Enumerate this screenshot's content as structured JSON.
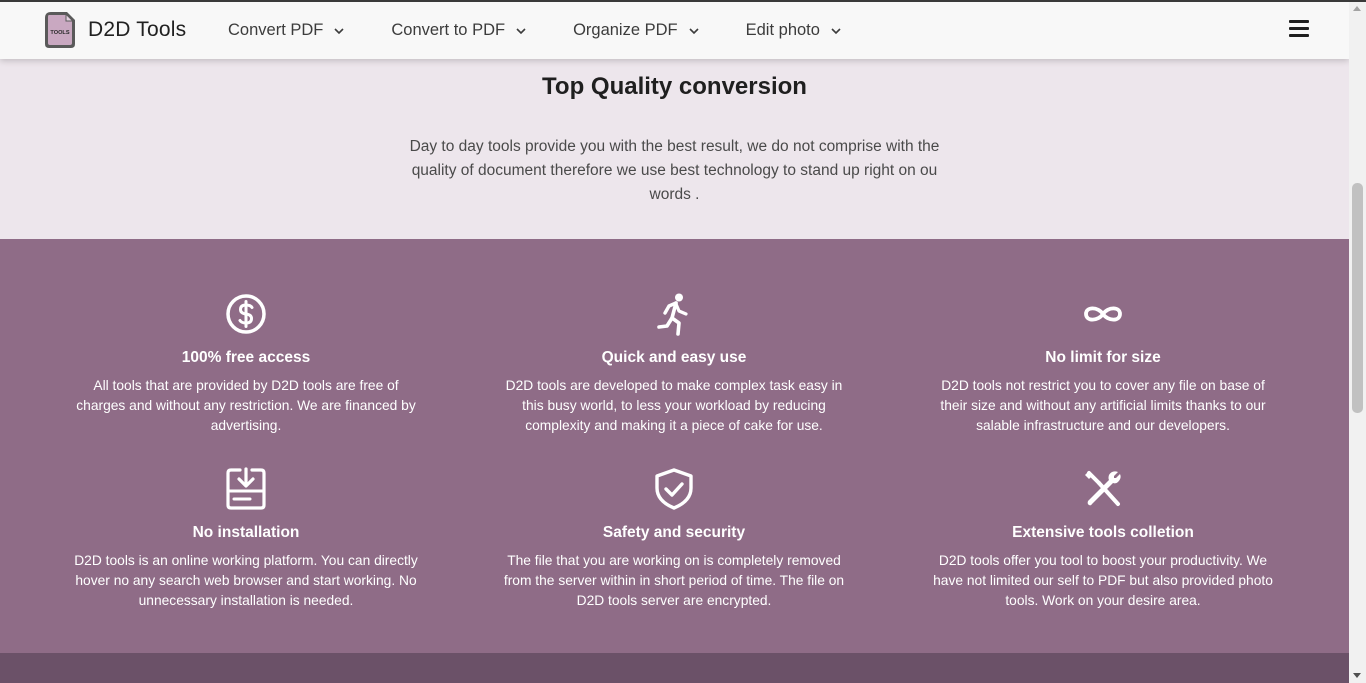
{
  "brand": {
    "name": "D2D Tools",
    "logo_text": "TOOLS",
    "logo_icon": "tools-file-logo"
  },
  "nav": {
    "items": [
      {
        "label": "Convert PDF",
        "icon": "chevron-down-icon"
      },
      {
        "label": "Convert to PDF",
        "icon": "chevron-down-icon"
      },
      {
        "label": "Organize PDF",
        "icon": "chevron-down-icon"
      },
      {
        "label": "Edit photo",
        "icon": "chevron-down-icon"
      }
    ],
    "menu_icon": "hamburger-menu-icon"
  },
  "intro": {
    "title": "Top Quality conversion",
    "text": "Day to day tools provide you with the best result, we do not comprise with the quality of document therefore we use best technology to stand up right on ou words ."
  },
  "features": [
    {
      "icon": "dollar-circle-icon",
      "title": "100% free access",
      "text": "All tools that are provided by D2D tools are free of charges and without any restriction. We are financed by advertising."
    },
    {
      "icon": "running-person-icon",
      "title": "Quick and easy use",
      "text": "D2D tools are developed to make complex task easy in this busy world, to less your workload by reducing complexity and making it a piece of cake for use."
    },
    {
      "icon": "infinity-icon",
      "title": "No limit for size",
      "text": "D2D tools not restrict you to cover any file on base of their size and without any artificial limits thanks to our salable infrastructure and our developers."
    },
    {
      "icon": "install-download-icon",
      "title": "No installation",
      "text": "D2D tools is an online working platform. You can directly hover no any search web browser and start working. No unnecessary installation is needed."
    },
    {
      "icon": "shield-check-icon",
      "title": "Safety and security",
      "text": "The file that you are working on is completely removed from the server within in short period of time. The file on D2D tools server are encrypted."
    },
    {
      "icon": "tools-icon",
      "title": "Extensive tools colletion",
      "text": "D2D tools offer you tool to boost your productivity. We have not limited our self to PDF but also provided photo tools. Work on your desire area."
    }
  ],
  "colors": {
    "feature_band": "#8f6c87",
    "footer_band": "#6b5168",
    "page_background": "#ede6ec",
    "navbar": "#f8f8f8"
  }
}
